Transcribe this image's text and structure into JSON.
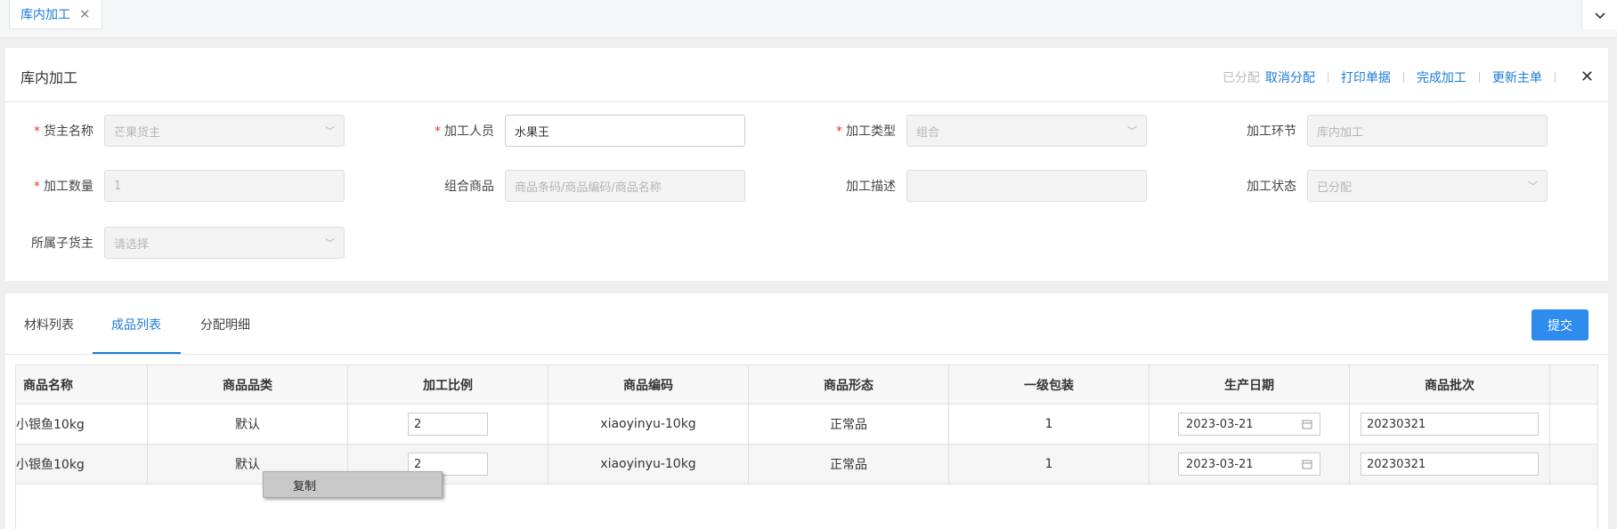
{
  "tabbar": {
    "tab_label": "库内加工",
    "close_glyph": "✕",
    "dropdown_glyph": "⌄"
  },
  "header": {
    "title": "库内加工",
    "status": "已分配",
    "actions": [
      "取消分配",
      "打印单据",
      "完成加工",
      "更新主单"
    ],
    "close_glyph": "✕"
  },
  "form": {
    "owner": {
      "label": "货主名称",
      "value": "芒果货主"
    },
    "worker": {
      "label": "加工人员",
      "value": "水果王"
    },
    "type": {
      "label": "加工类型",
      "value": "组合"
    },
    "stage": {
      "label": "加工环节",
      "value": "库内加工"
    },
    "quantity": {
      "label": "加工数量",
      "value": "1"
    },
    "combo": {
      "label": "组合商品",
      "placeholder": "商品条码/商品编码/商品名称"
    },
    "desc": {
      "label": "加工描述",
      "value": ""
    },
    "state": {
      "label": "加工状态",
      "value": "已分配"
    },
    "sub_owner": {
      "label": "所属子货主",
      "placeholder": "请选择"
    }
  },
  "detail_tabs": [
    "材料列表",
    "成品列表",
    "分配明细"
  ],
  "active_tab": "成品列表",
  "submit_label": "提交",
  "table": {
    "columns": [
      "商品名称",
      "商品品类",
      "加工比例",
      "商品编码",
      "商品形态",
      "一级包装",
      "生产日期",
      "商品批次"
    ],
    "rows": [
      {
        "name": "小银鱼10kg",
        "category": "默认",
        "ratio": "2",
        "code": "xiaoyinyu-10kg",
        "form": "正常品",
        "pack": "1",
        "date": "2023-03-21",
        "batch": "20230321"
      },
      {
        "name": "小银鱼10kg",
        "category": "默认",
        "ratio": "2",
        "code": "xiaoyinyu-10kg",
        "form": "正常品",
        "pack": "1",
        "date": "2023-03-21",
        "batch": "20230321"
      }
    ]
  },
  "context_menu": {
    "item": "复制"
  },
  "colors": {
    "accent": "#1a7bd8",
    "button": "#2d8ced",
    "required": "#e53935"
  }
}
